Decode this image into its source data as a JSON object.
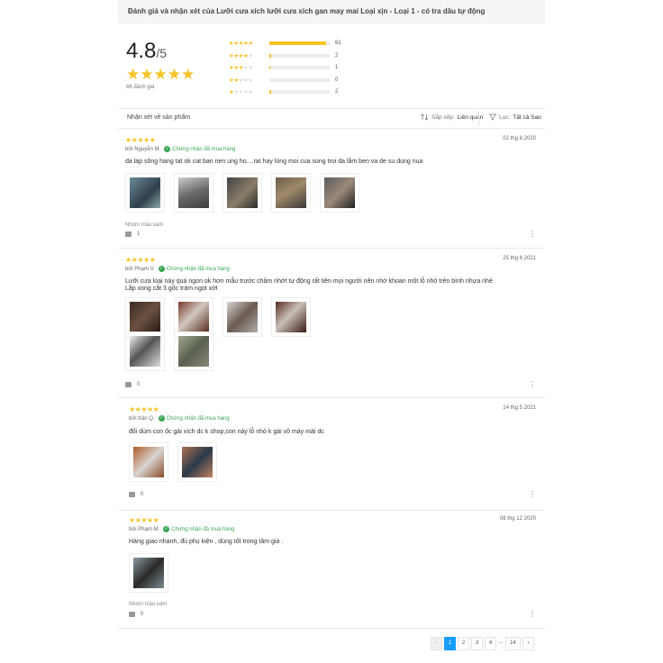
{
  "header": {
    "title": "Đánh giá và nhận xét của Lưỡi cưa xích lưỡi cưa xích gan may mai Loại xịn - Loại 1 - có tra dầu tự động"
  },
  "summary": {
    "average": "4.8",
    "out_of": "/5",
    "review_count": "66 đánh giá",
    "distribution": [
      {
        "stars": 5,
        "count": "61",
        "fraction": 0.94
      },
      {
        "stars": 4,
        "count": "2",
        "fraction": 0.03
      },
      {
        "stars": 3,
        "count": "1",
        "fraction": 0.02
      },
      {
        "stars": 2,
        "count": "0",
        "fraction": 0
      },
      {
        "stars": 1,
        "count": "2",
        "fraction": 0.03
      }
    ]
  },
  "filters": {
    "title": "Nhận xét về sản phẩm",
    "sort_label": "Sắp xếp:",
    "sort_value": "Liên quan",
    "filter_label": "Lọc:",
    "filter_value": "Tất cả Sao"
  },
  "verified_label": "Chứng nhận đã mua hàng",
  "reviews": [
    {
      "stars": "★★★★★",
      "author": "bởi Nguyễn M.",
      "date": "02 thg 8 2020",
      "text_lines": [
        "da lap sông hang tat ok cat ban nen ung ho....rat hay lòng moi cua song troi da lắm ben va de su dung nua"
      ],
      "variant": "Nhóm màu:xám",
      "likes": "1"
    },
    {
      "stars": "★★★★★",
      "author": "bởi Phạm V.",
      "date": "25 thg 6 2021",
      "text_lines": [
        "Lưỡi cưa loại này quá ngon ok hơn mẫu trước châm nhớt tự động rất tiện mọi người nên nhờ khoan một lỗ nhỏ trên bình nhựa nhé",
        "Lắp xong cắt 3 gốc tràm ngọt xớt"
      ],
      "variant": "",
      "likes": "0"
    },
    {
      "stars": "★★★★★",
      "author": "bởi trần Q.",
      "date": "14 thg 5 2021",
      "text_lines": [
        "đổi dùm con ốc gài xích dc k shop,con này lỗ nhỏ k gài vô máy mài dc"
      ],
      "variant": "",
      "likes": "0"
    },
    {
      "stars": "★★★★★",
      "author": "bởi Phạm M.",
      "date": "08 thg 12 2020",
      "text_lines": [
        "Hàng giao nhanh, đủ phụ kiện , dùng tốt trong tầm giá ."
      ],
      "variant": "Nhóm màu:xám",
      "likes": "0"
    }
  ],
  "pagination": {
    "prev": "‹",
    "pages": [
      "1",
      "2",
      "3",
      "4"
    ],
    "ellipsis": "...",
    "last": "14",
    "next": "›",
    "current": "1"
  },
  "colors": {
    "star": "#f7c325",
    "verified": "#3aa655",
    "active_page": "#189eff"
  }
}
